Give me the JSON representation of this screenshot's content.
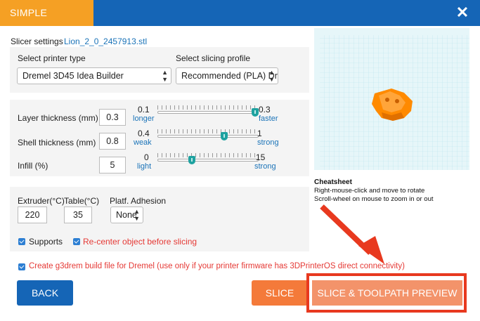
{
  "header": {
    "tab_label": "SIMPLE",
    "close_symbol": "✕"
  },
  "slicer": {
    "label": "Slicer settings",
    "filename": "Lion_2_0_2457913.stl"
  },
  "printer": {
    "label": "Select printer type",
    "value": "Dremel 3D45 Idea Builder"
  },
  "profile": {
    "label": "Select slicing profile",
    "value": "Recommended (PLA) Dr"
  },
  "layer": {
    "label": "Layer thickness (mm)",
    "value": "0.3",
    "min": "0.1",
    "min_caption": "longer",
    "max": "0.3",
    "max_caption": "faster",
    "slider_fraction": 1.0
  },
  "shell": {
    "label": "Shell thickness (mm)",
    "value": "0.8",
    "min": "0.4",
    "min_caption": "weak",
    "max": "1",
    "max_caption": "strong",
    "slider_fraction": 0.67
  },
  "infill": {
    "label": "Infill (%)",
    "value": "5",
    "min": "0",
    "min_caption": "light",
    "max": "15",
    "max_caption": "strong",
    "slider_fraction": 0.33
  },
  "temps": {
    "extruder_label": "Extruder(°C)",
    "extruder_value": "220",
    "table_label": "Table(°C)",
    "table_value": "35",
    "adhesion_label": "Platf. Adhesion",
    "adhesion_value": "None"
  },
  "options": {
    "supports_label": "Supports",
    "recenter_label": "Re-center object before slicing",
    "g3drem_label": "Create g3drem build file for Dremel (use only if your printer firmware has 3DPrinterOS direct connectivity)"
  },
  "buttons": {
    "back": "BACK",
    "slice": "SLICE",
    "preview": "SLICE & TOOLPATH PREVIEW"
  },
  "cheatsheet": {
    "title": "Cheatsheet",
    "line1": "Right-mouse-click and move to rotate",
    "line2": "Scroll-wheel on mouse to zoom in or out"
  },
  "colors": {
    "header_blue": "#1565b6",
    "tab_orange": "#f5a024",
    "slider_teal": "#1ea2a0",
    "annotation_red": "#e8391f",
    "model_orange": "#ff8a00"
  }
}
